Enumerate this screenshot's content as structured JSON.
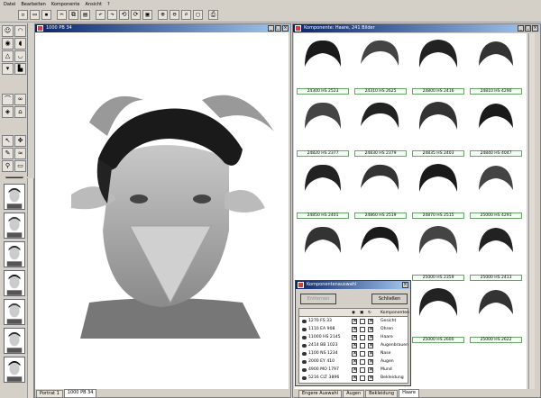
{
  "menu": [
    "Datei",
    "Bearbeiten",
    "Komponente",
    "Ansicht",
    "?"
  ],
  "canvas_window": {
    "title": "1000 PB 34"
  },
  "canvas_tabs": [
    "Portrat 1",
    "1000 PB 34"
  ],
  "hair_window": {
    "title": "Komponente: Haare, 241 Bilder"
  },
  "hair_items": [
    "24300 HS 2523",
    "24310 HS 2625",
    "24800 HS 2416",
    "24810 HS 4290",
    "24820 HS 2377",
    "24830 HS 2379",
    "24835 HS 2403",
    "24840 HS 4047",
    "24850 HS 2401",
    "24860 HS 2519",
    "24870 HS 2515",
    "25000 HS 4291",
    "",
    "",
    "25000 HS 2359",
    "25000 HS 2413",
    "",
    "",
    "25000 HS 2600",
    "25000 HS 2622"
  ],
  "hair_tabs": [
    "Engere Auswahl",
    "Augen",
    "Bekleidung",
    "Haare"
  ],
  "dialog": {
    "title": "Komponentenauswahl",
    "btn_disabled": "Entfernen",
    "btn_close": "Schließen",
    "col_header": "Komponenten",
    "rows": [
      {
        "code": "1270 FS 33",
        "name": "Gesicht"
      },
      {
        "code": "1110 EA 908",
        "name": "Ohren"
      },
      {
        "code": "11000 HS 2145",
        "name": "Haare"
      },
      {
        "code": "2414 BB 1023",
        "name": "Augenbrauen"
      },
      {
        "code": "1100 NS 1234",
        "name": "Nase"
      },
      {
        "code": "2000 EY 410",
        "name": "Augen"
      },
      {
        "code": "4900 MO 1797",
        "name": "Mund"
      },
      {
        "code": "5216 CLT 3896",
        "name": "Bekleidung"
      }
    ]
  }
}
